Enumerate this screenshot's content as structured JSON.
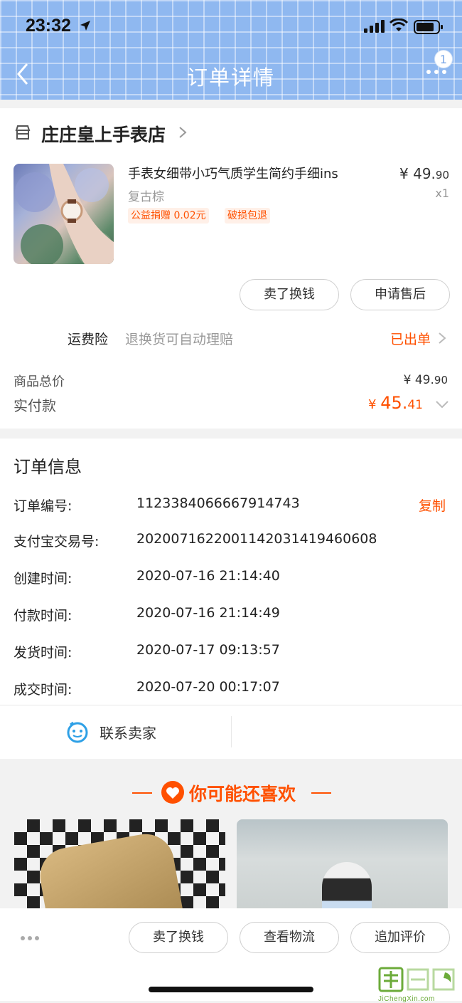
{
  "status_bar": {
    "time": "23:32"
  },
  "nav": {
    "title": "订单详情",
    "badge_count": "1"
  },
  "shop": {
    "name": "庄庄皇上手表店"
  },
  "product": {
    "title": "手表女细带小巧气质学生简约手细ins",
    "variant": "复古棕",
    "tags": [
      "公益捐赠 0.02元",
      "破损包退"
    ],
    "price_main": "¥ 49.",
    "price_small": "90",
    "quantity": "x1"
  },
  "item_actions": {
    "sell_label": "卖了换钱",
    "after_sale_label": "申请售后"
  },
  "insurance": {
    "label": "运费险",
    "description": "退换货可自动理赔",
    "status": "已出单"
  },
  "totals": {
    "goods_total_label": "商品总价",
    "goods_total_main": "¥ 49.",
    "goods_total_small": "90",
    "paid_label": "实付款",
    "paid_currency": "¥ ",
    "paid_main": "45.",
    "paid_small": "41"
  },
  "order_info": {
    "title": "订单信息",
    "copy_label": "复制",
    "rows": [
      {
        "label": "订单编号:",
        "value": "1123384066667914743"
      },
      {
        "label": "支付宝交易号:",
        "value": "2020071622001142031419460608"
      },
      {
        "label": "创建时间:",
        "value": "2020-07-16 21:14:40"
      },
      {
        "label": "付款时间:",
        "value": "2020-07-16 21:14:49"
      },
      {
        "label": "发货时间:",
        "value": "2020-07-17 09:13:57"
      },
      {
        "label": "成交时间:",
        "value": "2020-07-20 00:17:07"
      }
    ],
    "contact_label": "联系卖家"
  },
  "recommend": {
    "title": "你可能还喜欢"
  },
  "bottom_bar": {
    "sell_label": "卖了换钱",
    "logistics_label": "查看物流",
    "review_label": "追加评价"
  },
  "watermark": {
    "site": "JiChengXin.com"
  },
  "colors": {
    "accent": "#ff5000",
    "header_blue": "#8fb8f0"
  }
}
